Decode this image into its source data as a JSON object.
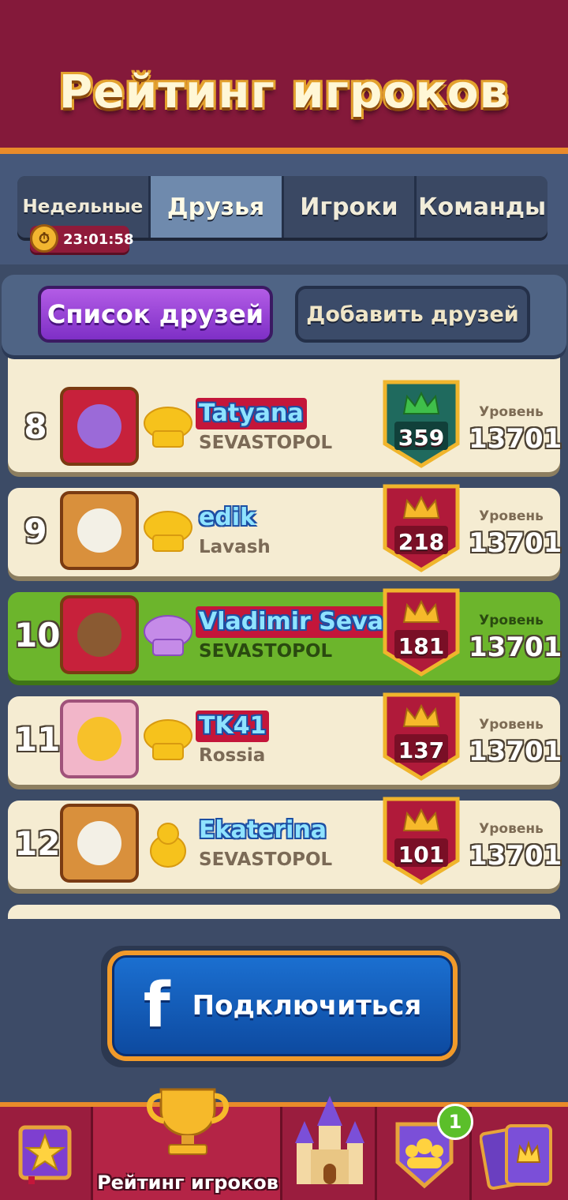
{
  "header": {
    "title": "Рейтинг игроков"
  },
  "tabs": [
    {
      "label": "Недельные",
      "active": false
    },
    {
      "label": "Друзья",
      "active": true
    },
    {
      "label": "Игроки",
      "active": false
    },
    {
      "label": "Команды",
      "active": false
    }
  ],
  "timer": "23:01:58",
  "subbar": {
    "friends_list": "Список друзей",
    "add_friends": "Добавить друзей"
  },
  "rows": [
    {
      "rank": "8",
      "name": "Tatyana",
      "sub": "SEVASTOPOL",
      "score": "359",
      "level_label": "Уровень",
      "level": "13701",
      "highlight": false,
      "shield_color": "#1f6a5e"
    },
    {
      "rank": "9",
      "name": "edik",
      "sub": "Lavash",
      "score": "218",
      "level_label": "Уровень",
      "level": "13701",
      "highlight": false,
      "shield_color": "#b01a3a"
    },
    {
      "rank": "10",
      "name": "Vladimir Sevas",
      "sub": "SEVASTOPOL",
      "score": "181",
      "level_label": "Уровень",
      "level": "13701",
      "highlight": true,
      "shield_color": "#b01a3a"
    },
    {
      "rank": "11",
      "name": "TK41",
      "sub": "Rossia",
      "score": "137",
      "level_label": "Уровень",
      "level": "13701",
      "highlight": false,
      "shield_color": "#b01a3a"
    },
    {
      "rank": "12",
      "name": "Ekaterina",
      "sub": "SEVASTOPOL",
      "score": "101",
      "level_label": "Уровень",
      "level": "13701",
      "highlight": false,
      "shield_color": "#b01a3a"
    }
  ],
  "connect": {
    "icon": "facebook-icon",
    "label": "Подключиться"
  },
  "nav": {
    "active_label": "Рейтинг игроков",
    "badge": "1"
  },
  "colors": {
    "accent": "#e98b2a",
    "header_bg": "#84193a",
    "highlight_row": "#6cb52c"
  }
}
